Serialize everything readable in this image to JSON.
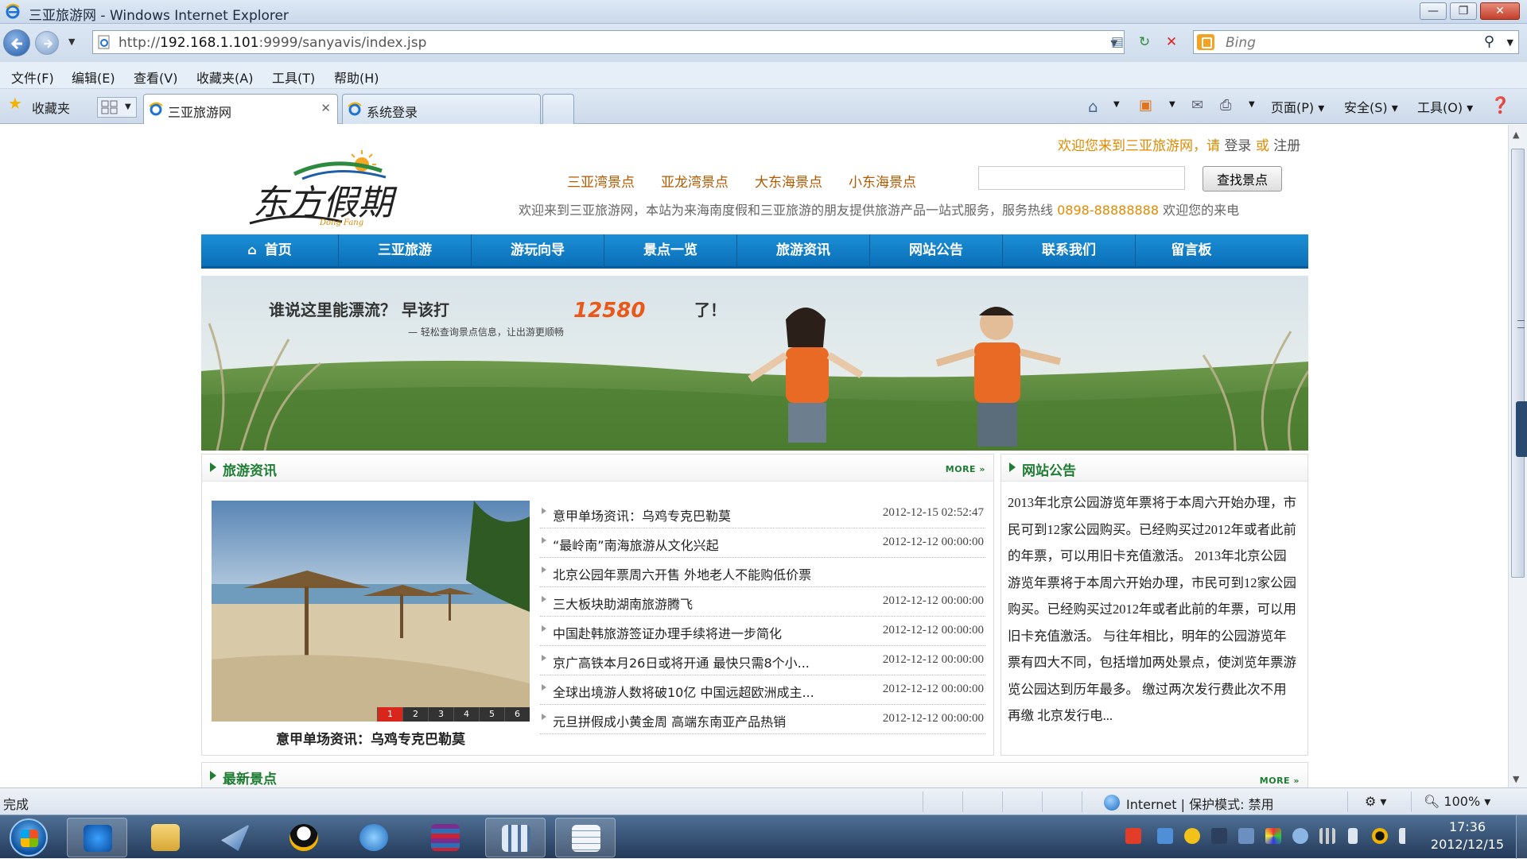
{
  "window": {
    "title": "三亚旅游网 - Windows Internet Explorer"
  },
  "address": {
    "url_prefix": "http://",
    "url_host": "192.168.1.101",
    "url_rest": ":9999/sanyavis/index.jsp",
    "search_placeholder": "Bing"
  },
  "menu": [
    "文件(F)",
    "编辑(E)",
    "查看(V)",
    "收藏夹(A)",
    "工具(T)",
    "帮助(H)"
  ],
  "favorites_label": "收藏夹",
  "tabs": [
    {
      "label": "三亚旅游网",
      "active": true
    },
    {
      "label": "系统登录",
      "active": false
    }
  ],
  "commandbar": {
    "page": "页面(P)",
    "safety": "安全(S)",
    "tools": "工具(O)"
  },
  "site": {
    "welcome_prefix": "欢迎您来到三亚旅游网，请",
    "login": "登录",
    "or": "或",
    "register": "注册",
    "logo_text": "东方假期",
    "top_links": [
      "三亚湾景点",
      "亚龙湾景点",
      "大东海景点",
      "小东海景点"
    ],
    "search_button": "查找景点",
    "service_text": "欢迎来到三亚旅游网，本站为来海南度假和三亚旅游的朋友提供旅游产品一站式服务，服务热线",
    "hotline": "0898-88888888",
    "service_suffix": "欢迎您的来电",
    "nav": [
      "首页",
      "三亚旅游",
      "游玩向导",
      "景点一览",
      "旅游资讯",
      "网站公告",
      "联系我们",
      "留言板"
    ],
    "banner": {
      "line1a": "谁说这里能漂流？ 早该打",
      "line1num": "12580",
      "line1b": "了！",
      "line2": "— 轻松查询景点信息，让出游更顺畅"
    },
    "news_panel": {
      "title": "旅游资讯",
      "more": "MORE",
      "photo_caption": "意甲单场资讯：乌鸡专克巴勒莫",
      "pager": [
        "1",
        "2",
        "3",
        "4",
        "5",
        "6"
      ],
      "items": [
        {
          "title": "意甲单场资讯：乌鸡专克巴勒莫",
          "date": "2012-12-15 02:52:47"
        },
        {
          "title": "“最岭南”南海旅游从文化兴起",
          "date": "2012-12-12 00:00:00"
        },
        {
          "title": "北京公园年票周六开售 外地老人不能购低价票",
          "date": ""
        },
        {
          "title": "三大板块助湖南旅游腾飞",
          "date": "2012-12-12 00:00:00"
        },
        {
          "title": "中国赴韩旅游签证办理手续将进一步简化",
          "date": "2012-12-12 00:00:00"
        },
        {
          "title": "京广高铁本月26日或将开通 最快只需8个小...",
          "date": "2012-12-12 00:00:00"
        },
        {
          "title": "全球出境游人数将破10亿 中国远超欧洲成主...",
          "date": "2012-12-12 00:00:00"
        },
        {
          "title": "元旦拼假成小黄金周 高端东南亚产品热销",
          "date": "2012-12-12 00:00:00"
        }
      ]
    },
    "notice_panel": {
      "title": "网站公告",
      "text": "2013年北京公园游览年票将于本周六开始办理，市民可到12家公园购买。已经购买过2012年或者此前的年票，可以用旧卡充值激活。 2013年北京公园游览年票将于本周六开始办理，市民可到12家公园购买。已经购买过2012年或者此前的年票，可以用旧卡充值激活。 与往年相比，明年的公园游览年票有四大不同，包括增加两处景点，使浏览年票游览公园达到历年最多。 缴过两次发行费此次不用再缴 北京发行电..."
    },
    "latest_panel": {
      "title": "最新景点",
      "more": "MORE"
    }
  },
  "status": {
    "left": "完成",
    "zone": "Internet | 保护模式: 禁用",
    "zoom": "100%"
  },
  "clock": {
    "time": "17:36",
    "date": "2012/12/15"
  },
  "colors": {
    "nav_blue": "#0a6fb8",
    "section_green": "#1e7d33",
    "hotline_orange": "#e08a00",
    "pager_active": "#d9261c"
  }
}
